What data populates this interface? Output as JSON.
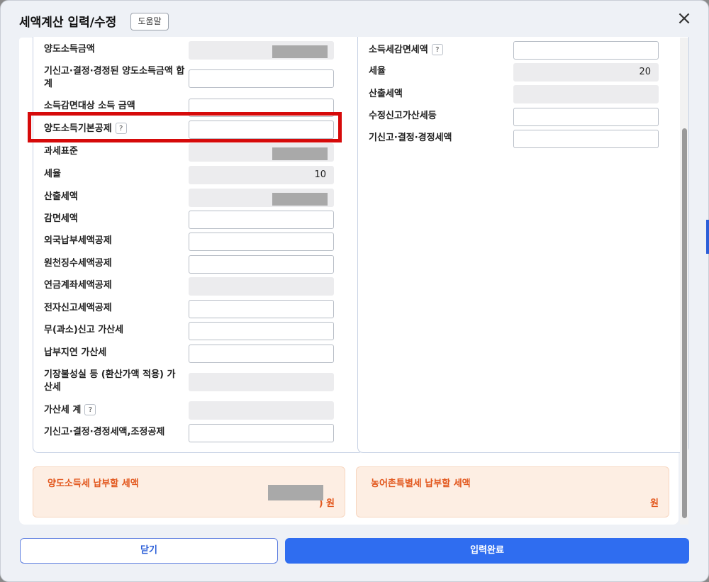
{
  "dialog": {
    "title": "세액계산 입력/수정",
    "help_label": "도움말",
    "close_icon": "close-icon"
  },
  "left_rows": [
    {
      "label": "양도소득금액",
      "readonly": true,
      "redacted": true
    },
    {
      "label": "기신고·결정·경정된 양도소득금액 합계",
      "readonly": false
    },
    {
      "label": "소득감면대상 소득 금액",
      "readonly": false
    },
    {
      "label": "양도소득기본공제",
      "help": "?",
      "readonly": false
    },
    {
      "label": "과세표준",
      "readonly": true,
      "redacted": true
    },
    {
      "label": "세율",
      "readonly": true,
      "value": "10"
    },
    {
      "label": "산출세액",
      "readonly": true,
      "redacted": true
    },
    {
      "label": "감면세액",
      "readonly": false
    },
    {
      "label": "외국납부세액공제",
      "readonly": false
    },
    {
      "label": "원천징수세액공제",
      "readonly": false
    },
    {
      "label": "연금계좌세액공제",
      "readonly": true
    },
    {
      "label": "전자신고세액공제",
      "readonly": false
    },
    {
      "label": "무(과소)신고 가산세",
      "readonly": false
    },
    {
      "label": "납부지연 가산세",
      "readonly": false
    },
    {
      "label": "기장불성실 등 (환산가액 적용) 가산세",
      "readonly": true
    },
    {
      "label": "가산세 계",
      "help": "?",
      "readonly": true
    },
    {
      "label": "기신고·결정·경정세액,조정공제",
      "readonly": false
    }
  ],
  "right_rows": [
    {
      "label": "소득세감면세액",
      "help": "?",
      "readonly": false
    },
    {
      "label": "세율",
      "readonly": true,
      "value": "20"
    },
    {
      "label": "산출세액",
      "readonly": true
    },
    {
      "label": "수정신고가산세등",
      "readonly": false
    },
    {
      "label": "기신고·결정·경정세액",
      "readonly": false
    }
  ],
  "summary": {
    "left_label": "양도소득세 납부할 세액",
    "left_amount": ") 원",
    "right_label": "농어촌특별세 납부할 세액",
    "right_amount": "원"
  },
  "buttons": {
    "close_label": "닫기",
    "submit_label": "입력완료"
  },
  "colors": {
    "primary": "#2f6df0",
    "highlight": "#d60a0a",
    "summary_text": "#e2571d"
  }
}
